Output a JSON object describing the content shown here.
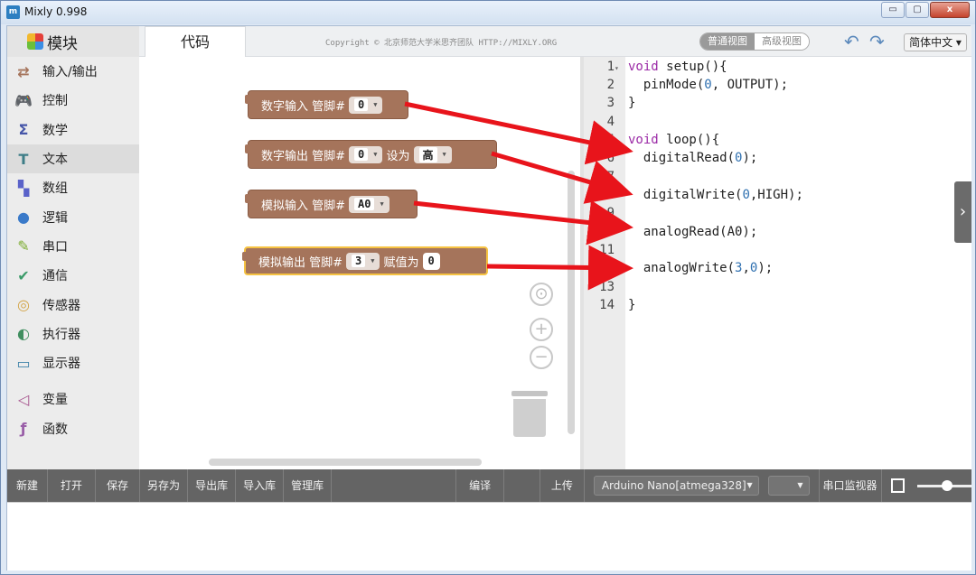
{
  "window": {
    "title": "Mixly 0.998",
    "icon": "m",
    "controls": [
      "▭",
      "▢",
      "x"
    ]
  },
  "sidebar": {
    "header": "模块",
    "categories": [
      {
        "label": "输入/输出",
        "icon": "io-icon",
        "color": "#a5745b"
      },
      {
        "label": "控制",
        "icon": "gamepad-icon",
        "color": "#4a9b3f"
      },
      {
        "label": "数学",
        "icon": "sigma-icon",
        "color": "#4656a8"
      },
      {
        "label": "文本",
        "icon": "text-icon",
        "color": "#3e7d87"
      },
      {
        "label": "数组",
        "icon": "array-icon",
        "color": "#5a62c9"
      },
      {
        "label": "逻辑",
        "icon": "bulb-icon",
        "color": "#3a7ac9"
      },
      {
        "label": "串口",
        "icon": "serial-icon",
        "color": "#7aab2e"
      },
      {
        "label": "通信",
        "icon": "comm-icon",
        "color": "#3b9b69"
      },
      {
        "label": "传感器",
        "icon": "sensor-icon",
        "color": "#d3a445"
      },
      {
        "label": "执行器",
        "icon": "actuator-icon",
        "color": "#3f8e5f"
      },
      {
        "label": "显示器",
        "icon": "display-icon",
        "color": "#3d82a8"
      },
      {
        "label": "变量",
        "icon": "variable-icon",
        "color": "#a4508b"
      },
      {
        "label": "函数",
        "icon": "function-icon",
        "color": "#9a5fa8"
      }
    ],
    "active_index": 3
  },
  "tabs": {
    "code": "代码"
  },
  "copyright": "Copyright © 北京师范大学米思齐团队 HTTP://MIXLY.ORG",
  "view": {
    "normal": "普通视图",
    "advanced": "高级视图"
  },
  "language": "简体中文",
  "blocks": [
    {
      "label": "数字输入 管脚#",
      "pin": "0"
    },
    {
      "label": "数字输出 管脚#",
      "pin": "0",
      "set_label": "设为",
      "value": "高"
    },
    {
      "label": "模拟输入 管脚#",
      "pin": "A0"
    },
    {
      "label": "模拟输出 管脚#",
      "pin": "3",
      "assign_label": "赋值为",
      "value": "0"
    }
  ],
  "code": {
    "lines": [
      "1",
      "2",
      "3",
      "4",
      "5",
      "6",
      "7",
      "8",
      "9",
      "10",
      "11",
      "12",
      "13",
      "14"
    ]
  },
  "toolbar": {
    "new": "新建",
    "open": "打开",
    "save": "保存",
    "save_as": "另存为",
    "export_lib": "导出库",
    "import_lib": "导入库",
    "manage_lib": "管理库",
    "compile": "编译",
    "upload": "上传",
    "board": "Arduino Nano[atmega328]",
    "port": "",
    "serial_monitor": "串口监视器"
  },
  "zoom_slider_level": 0.55
}
